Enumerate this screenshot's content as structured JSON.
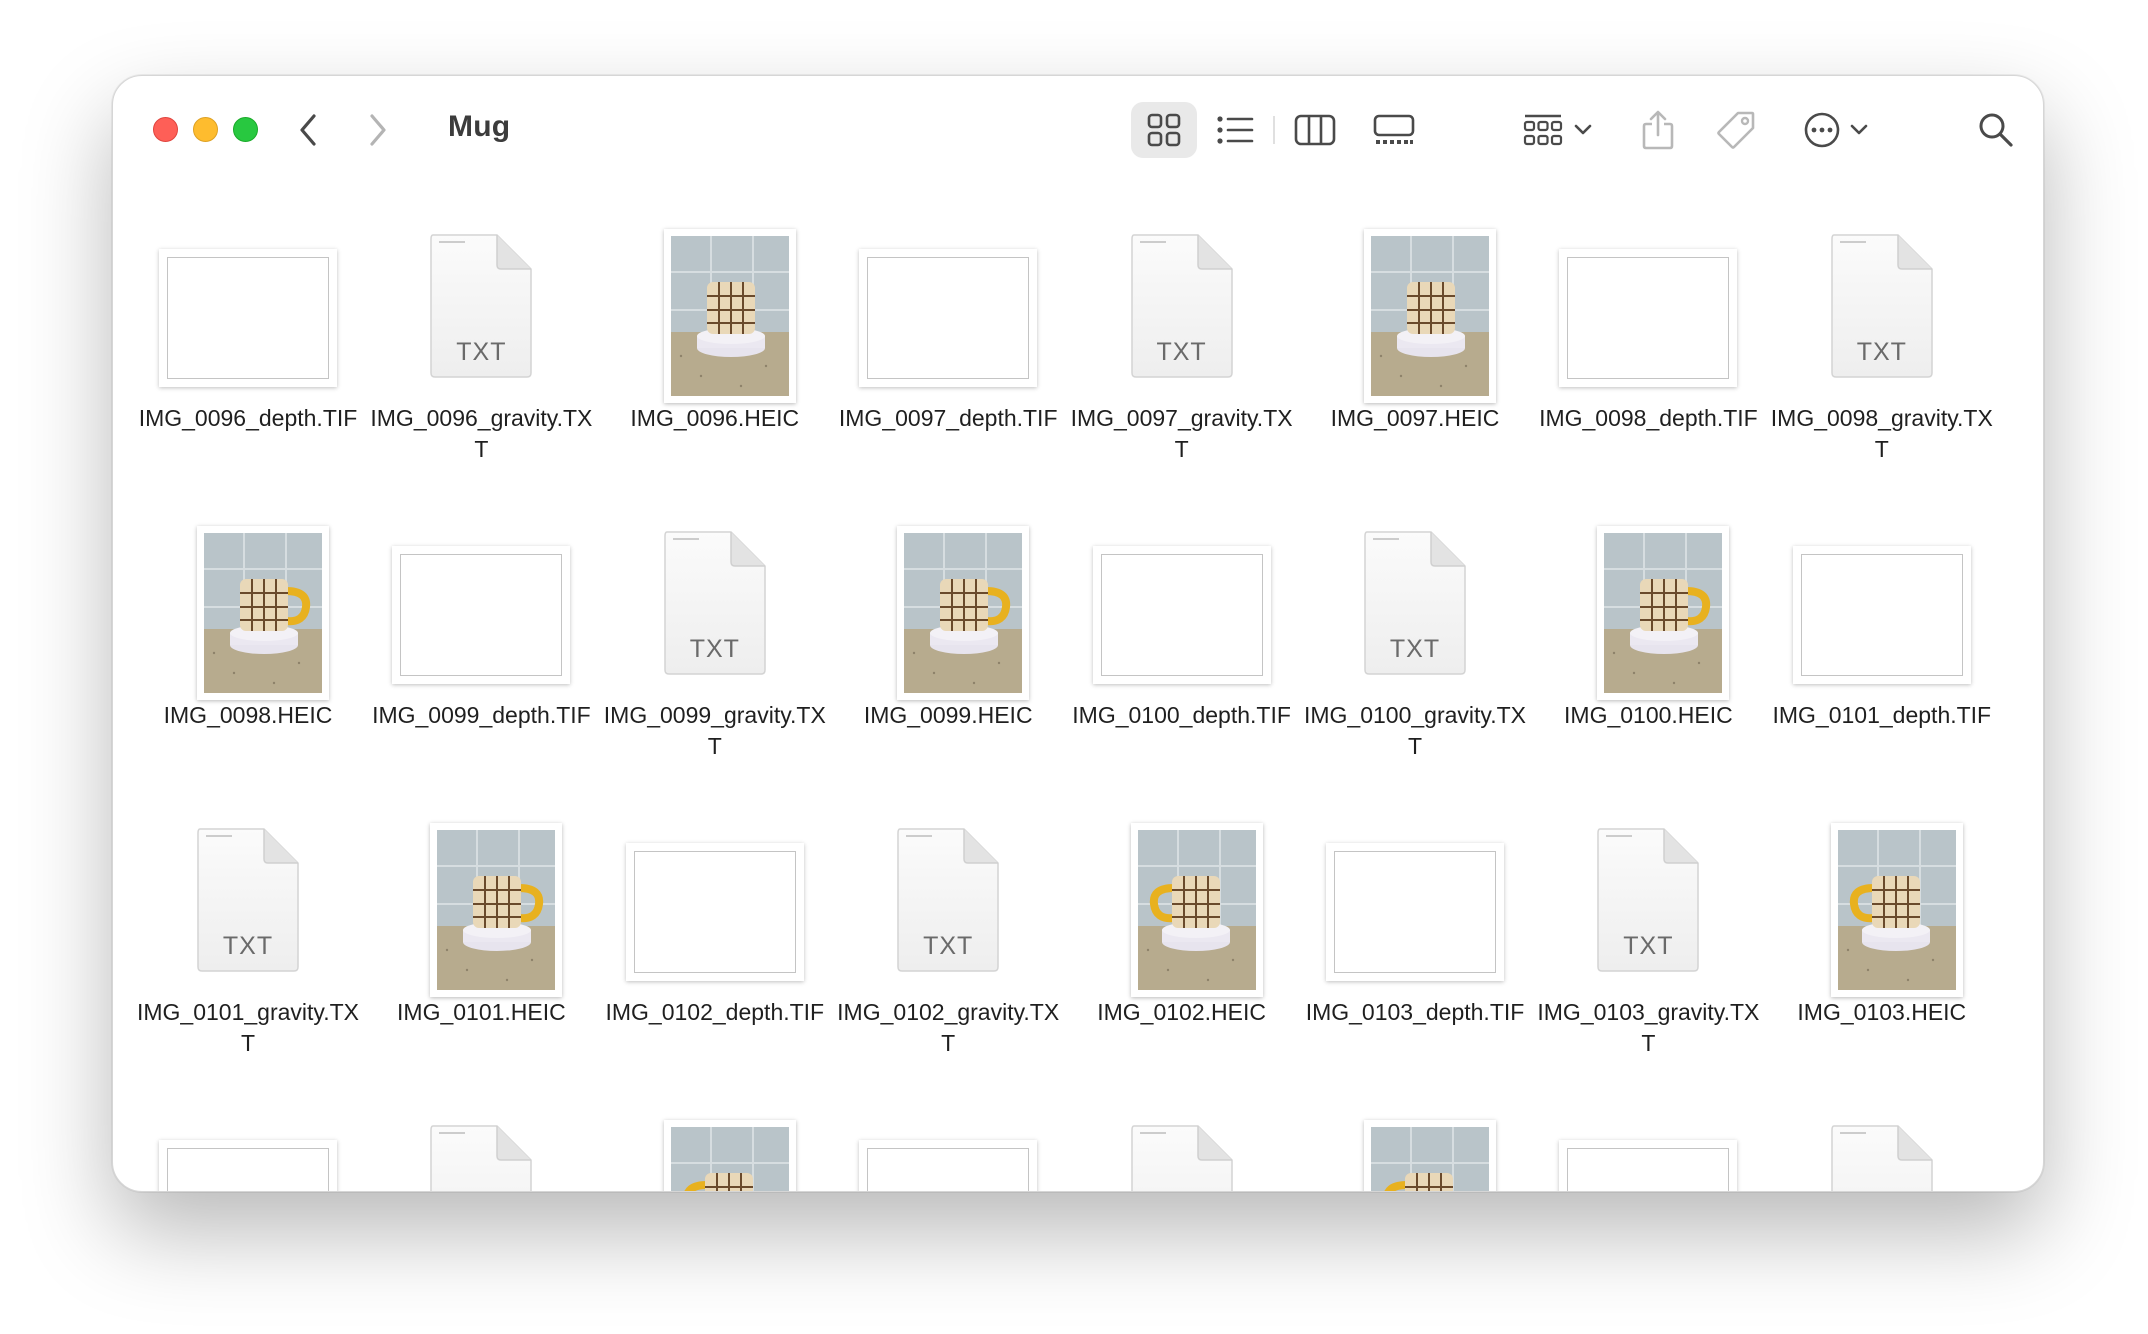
{
  "window": {
    "title": "Mug"
  },
  "toolbar": {
    "view_modes": [
      "icon-view",
      "list-view",
      "column-view",
      "gallery-view"
    ],
    "active_view": "icon-view"
  },
  "doc_badge": "TXT",
  "files": [
    {
      "name": "IMG_0096_depth.TIF",
      "kind": "tif"
    },
    {
      "name": "IMG_0096_gravity.TXT",
      "kind": "txt"
    },
    {
      "name": "IMG_0096.HEIC",
      "kind": "heic"
    },
    {
      "name": "IMG_0097_depth.TIF",
      "kind": "tif"
    },
    {
      "name": "IMG_0097_gravity.TXT",
      "kind": "txt"
    },
    {
      "name": "IMG_0097.HEIC",
      "kind": "heic"
    },
    {
      "name": "IMG_0098_depth.TIF",
      "kind": "tif"
    },
    {
      "name": "IMG_0098_gravity.TXT",
      "kind": "txt"
    },
    {
      "name": "IMG_0098.HEIC",
      "kind": "heic"
    },
    {
      "name": "IMG_0099_depth.TIF",
      "kind": "tif"
    },
    {
      "name": "IMG_0099_gravity.TXT",
      "kind": "txt"
    },
    {
      "name": "IMG_0099.HEIC",
      "kind": "heic"
    },
    {
      "name": "IMG_0100_depth.TIF",
      "kind": "tif"
    },
    {
      "name": "IMG_0100_gravity.TXT",
      "kind": "txt"
    },
    {
      "name": "IMG_0100.HEIC",
      "kind": "heic"
    },
    {
      "name": "IMG_0101_depth.TIF",
      "kind": "tif"
    },
    {
      "name": "IMG_0101_gravity.TXT",
      "kind": "txt"
    },
    {
      "name": "IMG_0101.HEIC",
      "kind": "heic"
    },
    {
      "name": "IMG_0102_depth.TIF",
      "kind": "tif"
    },
    {
      "name": "IMG_0102_gravity.TXT",
      "kind": "txt"
    },
    {
      "name": "IMG_0102.HEIC",
      "kind": "heic"
    },
    {
      "name": "IMG_0103_depth.TIF",
      "kind": "tif"
    },
    {
      "name": "IMG_0103_gravity.TXT",
      "kind": "txt"
    },
    {
      "name": "IMG_0103.HEIC",
      "kind": "heic"
    },
    {
      "name": "",
      "kind": "tif"
    },
    {
      "name": "",
      "kind": "txt"
    },
    {
      "name": "",
      "kind": "heic"
    },
    {
      "name": "",
      "kind": "tif"
    },
    {
      "name": "",
      "kind": "txt"
    },
    {
      "name": "",
      "kind": "heic"
    },
    {
      "name": "",
      "kind": "tif"
    },
    {
      "name": "",
      "kind": "txt"
    }
  ],
  "colors": {
    "close": "#fe5f57",
    "minimize": "#febc2e",
    "maximize": "#28c840",
    "mug_handle": "#e8b11f"
  }
}
